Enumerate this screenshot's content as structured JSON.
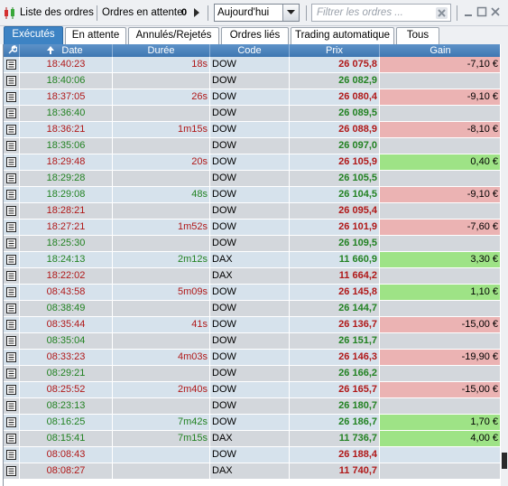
{
  "toolbar": {
    "title": "Liste des ordres",
    "pending_label": "Ordres en attente",
    "pending_count": "0",
    "period_value": "Aujourd'hui",
    "filter_placeholder": "Filtrer les ordres ..."
  },
  "tabs": [
    {
      "label": "Exécutés",
      "active": true
    },
    {
      "label": "En attente",
      "active": false
    },
    {
      "label": "Annulés/Rejetés",
      "active": false
    },
    {
      "label": "Ordres liés",
      "active": false
    },
    {
      "label": "Trading automatique",
      "active": false
    },
    {
      "label": "Tous",
      "active": false
    }
  ],
  "columns": {
    "date": "Date",
    "duration": "Durée",
    "code": "Code",
    "price": "Prix",
    "gain": "Gain"
  },
  "colors": {
    "row_light": "#d6e2ec",
    "row_dark": "#d3d7dc",
    "gain_positive": "#9ee386",
    "gain_negative": "#ebb3b3",
    "text_red": "#b01818",
    "text_green": "#228222",
    "accent": "#3d83c4"
  },
  "rows": [
    {
      "date": "18:40:23",
      "side": "sell",
      "duration": "18s",
      "code": "DOW",
      "price": "26 075,8",
      "gain": "-7,10 €",
      "gain_sign": "neg"
    },
    {
      "date": "18:40:06",
      "side": "buy",
      "duration": "",
      "code": "DOW",
      "price": "26 082,9",
      "gain": "",
      "gain_sign": ""
    },
    {
      "date": "18:37:05",
      "side": "sell",
      "duration": "26s",
      "code": "DOW",
      "price": "26 080,4",
      "gain": "-9,10 €",
      "gain_sign": "neg"
    },
    {
      "date": "18:36:40",
      "side": "buy",
      "duration": "",
      "code": "DOW",
      "price": "26 089,5",
      "gain": "",
      "gain_sign": ""
    },
    {
      "date": "18:36:21",
      "side": "sell",
      "duration": "1m15s",
      "code": "DOW",
      "price": "26 088,9",
      "gain": "-8,10 €",
      "gain_sign": "neg"
    },
    {
      "date": "18:35:06",
      "side": "buy",
      "duration": "",
      "code": "DOW",
      "price": "26 097,0",
      "gain": "",
      "gain_sign": ""
    },
    {
      "date": "18:29:48",
      "side": "sell",
      "duration": "20s",
      "code": "DOW",
      "price": "26 105,9",
      "gain": "0,40 €",
      "gain_sign": "pos"
    },
    {
      "date": "18:29:28",
      "side": "buy",
      "duration": "",
      "code": "DOW",
      "price": "26 105,5",
      "gain": "",
      "gain_sign": ""
    },
    {
      "date": "18:29:08",
      "side": "buy",
      "duration": "48s",
      "code": "DOW",
      "price": "26 104,5",
      "gain": "-9,10 €",
      "gain_sign": "neg"
    },
    {
      "date": "18:28:21",
      "side": "sell",
      "duration": "",
      "code": "DOW",
      "price": "26 095,4",
      "gain": "",
      "gain_sign": ""
    },
    {
      "date": "18:27:21",
      "side": "sell",
      "duration": "1m52s",
      "code": "DOW",
      "price": "26 101,9",
      "gain": "-7,60 €",
      "gain_sign": "neg"
    },
    {
      "date": "18:25:30",
      "side": "buy",
      "duration": "",
      "code": "DOW",
      "price": "26 109,5",
      "gain": "",
      "gain_sign": ""
    },
    {
      "date": "18:24:13",
      "side": "buy",
      "duration": "2m12s",
      "code": "DAX",
      "price": "11 660,9",
      "gain": "3,30 €",
      "gain_sign": "pos"
    },
    {
      "date": "18:22:02",
      "side": "sell",
      "duration": "",
      "code": "DAX",
      "price": "11 664,2",
      "gain": "",
      "gain_sign": ""
    },
    {
      "date": "08:43:58",
      "side": "sell",
      "duration": "5m09s",
      "code": "DOW",
      "price": "26 145,8",
      "gain": "1,10 €",
      "gain_sign": "pos"
    },
    {
      "date": "08:38:49",
      "side": "buy",
      "duration": "",
      "code": "DOW",
      "price": "26 144,7",
      "gain": "",
      "gain_sign": ""
    },
    {
      "date": "08:35:44",
      "side": "sell",
      "duration": "41s",
      "code": "DOW",
      "price": "26 136,7",
      "gain": "-15,00 €",
      "gain_sign": "neg"
    },
    {
      "date": "08:35:04",
      "side": "buy",
      "duration": "",
      "code": "DOW",
      "price": "26 151,7",
      "gain": "",
      "gain_sign": ""
    },
    {
      "date": "08:33:23",
      "side": "sell",
      "duration": "4m03s",
      "code": "DOW",
      "price": "26 146,3",
      "gain": "-19,90 €",
      "gain_sign": "neg"
    },
    {
      "date": "08:29:21",
      "side": "buy",
      "duration": "",
      "code": "DOW",
      "price": "26 166,2",
      "gain": "",
      "gain_sign": ""
    },
    {
      "date": "08:25:52",
      "side": "sell",
      "duration": "2m40s",
      "code": "DOW",
      "price": "26 165,7",
      "gain": "-15,00 €",
      "gain_sign": "neg"
    },
    {
      "date": "08:23:13",
      "side": "buy",
      "duration": "",
      "code": "DOW",
      "price": "26 180,7",
      "gain": "",
      "gain_sign": ""
    },
    {
      "date": "08:16:25",
      "side": "buy",
      "duration": "7m42s",
      "code": "DOW",
      "price": "26 186,7",
      "gain": "1,70 €",
      "gain_sign": "pos"
    },
    {
      "date": "08:15:41",
      "side": "buy",
      "duration": "7m15s",
      "code": "DAX",
      "price": "11 736,7",
      "gain": "4,00 €",
      "gain_sign": "pos"
    },
    {
      "date": "08:08:43",
      "side": "sell",
      "duration": "",
      "code": "DOW",
      "price": "26 188,4",
      "gain": "",
      "gain_sign": ""
    },
    {
      "date": "08:08:27",
      "side": "sell",
      "duration": "",
      "code": "DAX",
      "price": "11 740,7",
      "gain": "",
      "gain_sign": ""
    }
  ]
}
